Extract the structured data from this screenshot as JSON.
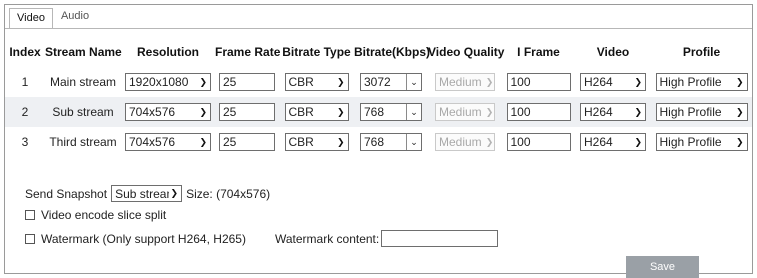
{
  "tabs": [
    {
      "label": "Video",
      "active": true
    },
    {
      "label": "Audio",
      "active": false
    }
  ],
  "table": {
    "headers": [
      "Index",
      "Stream Name",
      "Resolution",
      "Frame Rate",
      "Bitrate Type",
      "Bitrate(Kbps)",
      "Video Quality",
      "I Frame",
      "Video",
      "Profile"
    ],
    "rows": [
      {
        "index": "1",
        "name": "Main stream",
        "resolution": "1920x1080",
        "frame_rate": "25",
        "bitrate_type": "CBR",
        "bitrate": "3072",
        "quality": "Medium",
        "iframe": "100",
        "video": "H264",
        "profile": "High Profile"
      },
      {
        "index": "2",
        "name": "Sub stream",
        "resolution": "704x576",
        "frame_rate": "25",
        "bitrate_type": "CBR",
        "bitrate": "768",
        "quality": "Medium",
        "iframe": "100",
        "video": "H264",
        "profile": "High Profile"
      },
      {
        "index": "3",
        "name": "Third stream",
        "resolution": "704x576",
        "frame_rate": "25",
        "bitrate_type": "CBR",
        "bitrate": "768",
        "quality": "Medium",
        "iframe": "100",
        "video": "H264",
        "profile": "High Profile"
      }
    ]
  },
  "options": {
    "send_snapshot_label": "Send Snapshot",
    "send_snapshot_value": "Sub stream",
    "size_text": "Size: (704x576)",
    "slice_split_label": "Video encode slice split",
    "watermark_label": "Watermark (Only support H264, H265)",
    "watermark_content_label": "Watermark content:",
    "watermark_content_value": ""
  },
  "save_label": "Save",
  "colors": {
    "row_alt": "#eef0f3",
    "save_bg": "#9aa0a6",
    "border": "#b7b7b7"
  }
}
